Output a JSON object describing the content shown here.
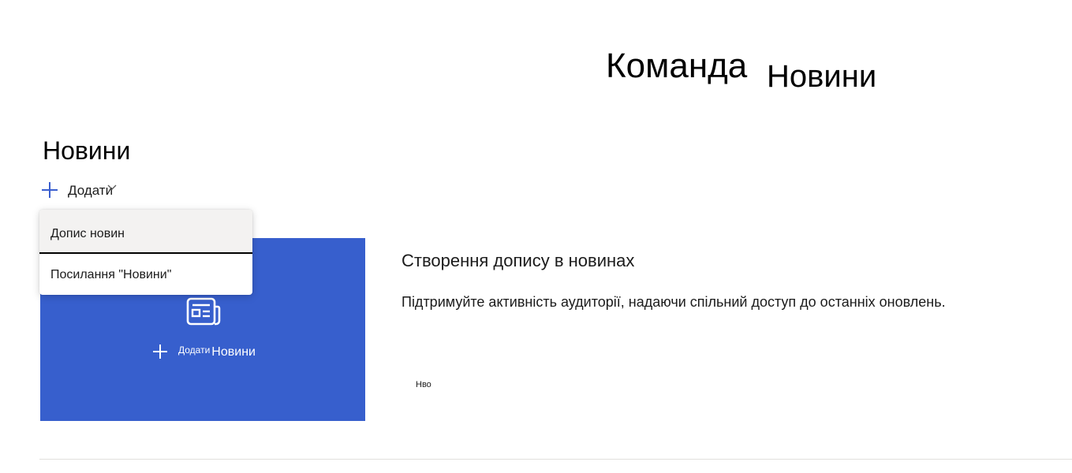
{
  "site": {
    "title_part1": "Команда",
    "title_part2": "Новини"
  },
  "news": {
    "section_title": "Новини",
    "add_label": "Додати",
    "menu": {
      "items": [
        {
          "label": "Допис новин"
        },
        {
          "label": "Посилання \"Новини\""
        }
      ]
    },
    "tile": {
      "add_small": "Додати",
      "add_news": "Новини"
    },
    "promo": {
      "heading": "Створення допису в новинах",
      "text": "Підтримуйте активність аудиторії, надаючи спільний доступ до останніх оновлень.",
      "small_label": "Нво"
    }
  },
  "colors": {
    "accent": "#375fcd",
    "plus_icon": "#3b5fcf"
  },
  "icons": {
    "add": "plus-icon",
    "dropdown": "chevron-down-icon",
    "news": "news-icon"
  }
}
